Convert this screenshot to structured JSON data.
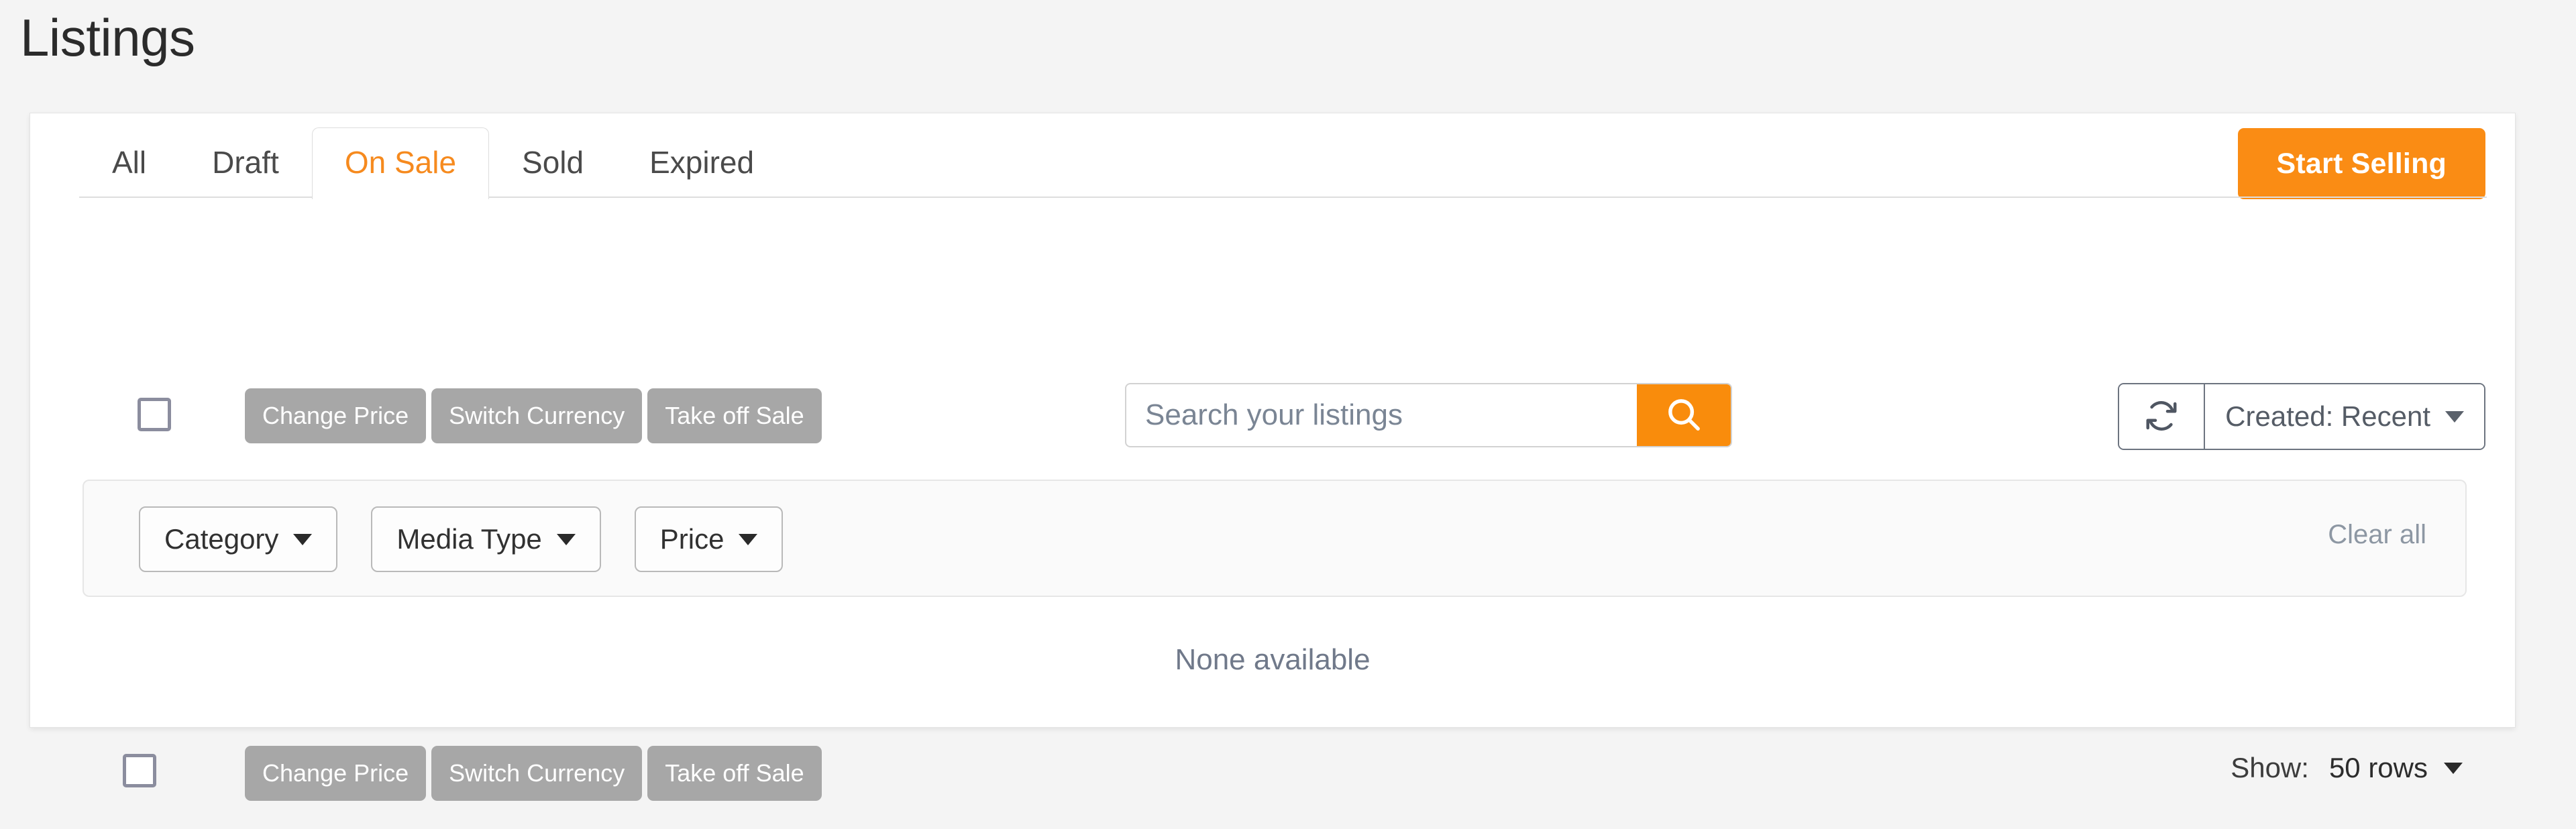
{
  "page": {
    "title": "Listings",
    "background_color": "#f4f4f4",
    "accent_color": "#f98c0c"
  },
  "tabs": [
    {
      "label": "All",
      "active": false
    },
    {
      "label": "Draft",
      "active": false
    },
    {
      "label": "On Sale",
      "active": true
    },
    {
      "label": "Sold",
      "active": false
    },
    {
      "label": "Expired",
      "active": false
    }
  ],
  "header": {
    "start_selling_label": "Start Selling"
  },
  "toolbar": {
    "actions": [
      {
        "label": "Change Price"
      },
      {
        "label": "Switch Currency"
      },
      {
        "label": "Take off Sale"
      }
    ],
    "search": {
      "value": "",
      "placeholder": "Search your listings",
      "icon": "search-icon"
    },
    "refresh_icon": "refresh-icon",
    "sort": {
      "label": "Created: Recent",
      "icon": "chevron-down-icon"
    },
    "select_all_checkbox": {
      "checked": false
    }
  },
  "filters": {
    "items": [
      {
        "label": "Category",
        "icon": "chevron-down-icon"
      },
      {
        "label": "Media Type",
        "icon": "chevron-down-icon"
      },
      {
        "label": "Price",
        "icon": "chevron-down-icon"
      }
    ],
    "clear_all_label": "Clear all"
  },
  "content": {
    "empty_message": "None available"
  },
  "footer": {
    "actions": [
      {
        "label": "Change Price"
      },
      {
        "label": "Switch Currency"
      },
      {
        "label": "Take off Sale"
      }
    ],
    "show_label": "Show:",
    "rows_value": "50 rows",
    "rows_icon": "chevron-down-icon",
    "select_all_checkbox": {
      "checked": false
    }
  }
}
